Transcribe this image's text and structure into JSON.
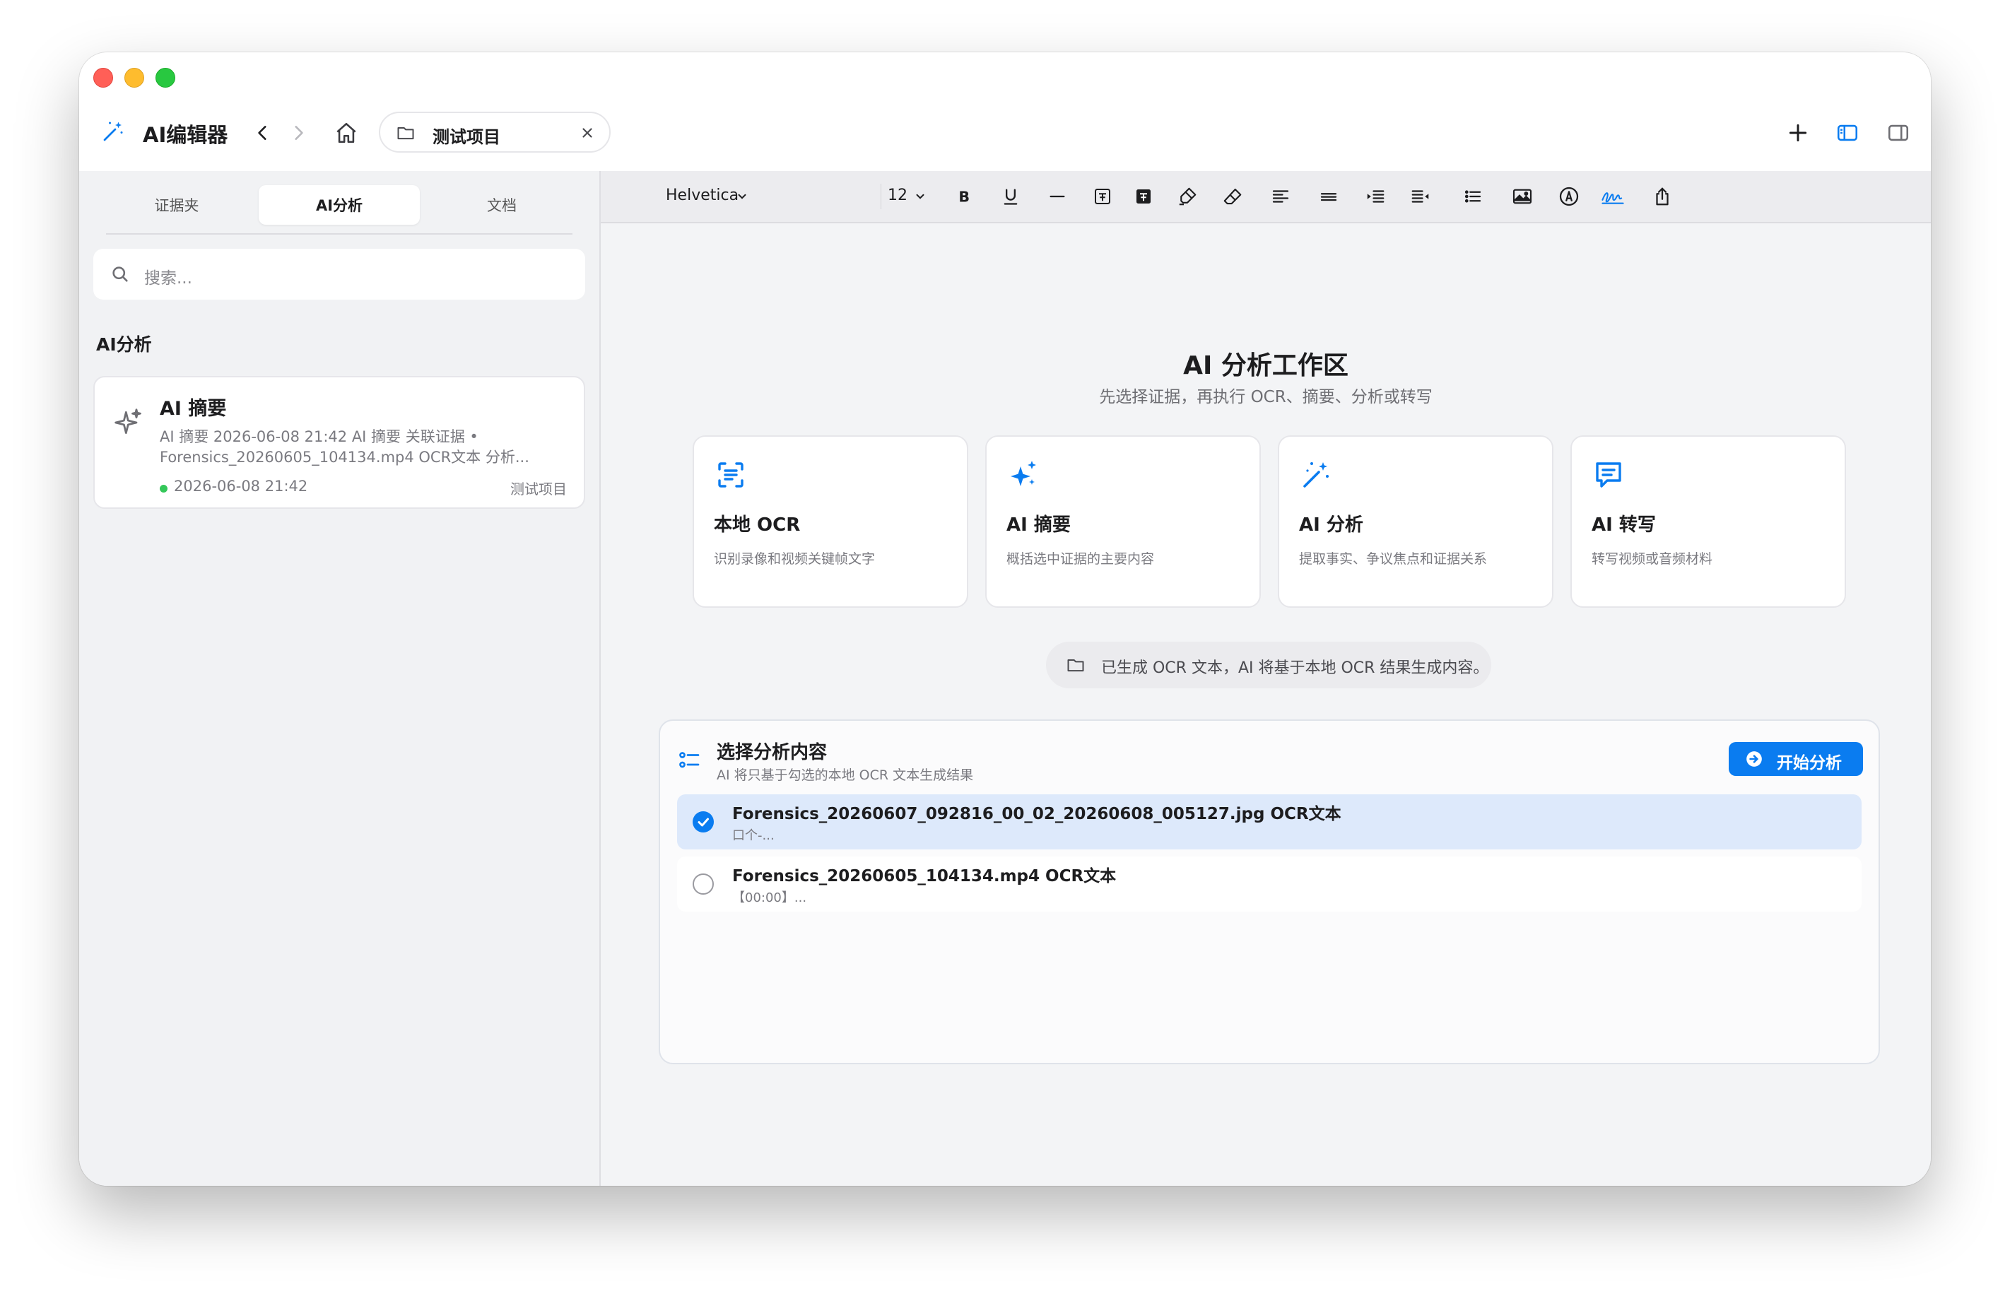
{
  "window": {
    "title": "AI编辑器"
  },
  "project_tab": {
    "label": "测试项目"
  },
  "sidebar": {
    "segments": [
      {
        "label": "证据夹"
      },
      {
        "label": "AI分析"
      },
      {
        "label": "文档"
      }
    ],
    "search_placeholder": "搜索...",
    "section_title": "AI分析",
    "items": [
      {
        "title": "AI 摘要",
        "desc_line1": "AI 摘要 2026-06-08 21:42  AI 摘要  关联证据 •",
        "desc_line2": "Forensics_20260605_104134.mp4 OCR文本   分析...",
        "time": "2026-06-08 21:42",
        "project": "测试项目"
      }
    ]
  },
  "toolbar": {
    "font": "Helvetica",
    "size": "12"
  },
  "workspace": {
    "title": "AI 分析工作区",
    "subtitle": "先选择证据，再执行 OCR、摘要、分析或转写",
    "features": [
      {
        "icon": "ocr-scan-icon",
        "title": "本地 OCR",
        "desc": "识别录像和视频关键帧文字"
      },
      {
        "icon": "sparkles-icon",
        "title": "AI 摘要",
        "desc": "概括选中证据的主要内容"
      },
      {
        "icon": "magic-wand-icon",
        "title": "AI 分析",
        "desc": "提取事实、争议焦点和证据关系"
      },
      {
        "icon": "chat-bubble-icon",
        "title": "AI 转写",
        "desc": "转写视频或音频材料"
      }
    ],
    "notice": "已生成 OCR 文本，AI 将基于本地 OCR 结果生成内容。"
  },
  "panel": {
    "title": "选择分析内容",
    "subtitle": "AI 将只基于勾选的本地 OCR 文本生成结果",
    "start_label": "开始分析",
    "rows": [
      {
        "title": "Forensics_20260607_092816_00_02_20260608_005127.jpg OCR文本",
        "preview": "口个-...",
        "checked": true
      },
      {
        "title": "Forensics_20260605_104134.mp4 OCR文本",
        "preview": "【00:00】...",
        "checked": false
      }
    ]
  },
  "colors": {
    "accent": "#0a7cf0",
    "selected_row": "#dde9fb",
    "status_dot": "#34c759"
  }
}
